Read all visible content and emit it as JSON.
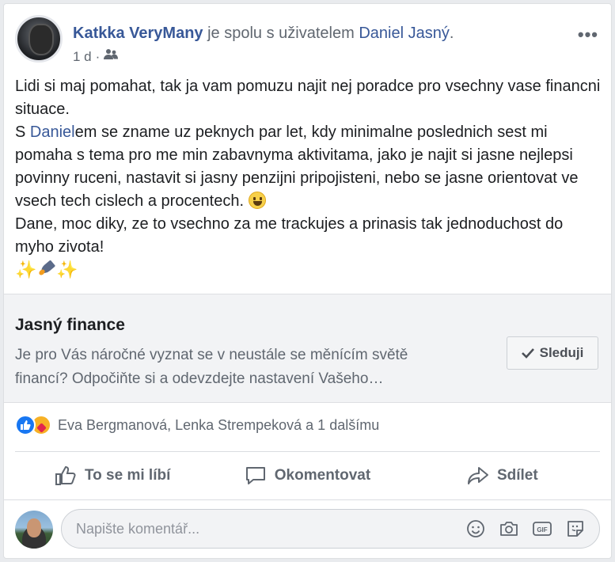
{
  "post": {
    "author": "Katkka VeryMany",
    "with_text": "je spolu s uživatelem",
    "tagged": "Daniel Jasný",
    "tagged_suffix": ".",
    "time": "1 d",
    "audience_icon": "friends-icon",
    "more_label": "•••",
    "text": {
      "line1": "Lidi si maj pomahat, tak ja vam pomuzu najit nej poradce pro vsechny vase financni situace.",
      "p2_pre": "S ",
      "p2_mention": "Daniel",
      "p2_post": "em se zname uz peknych par let, kdy minimalne poslednich sest mi pomaha s tema pro me min zabavnyma aktivitama, jako je najit si jasne nejlepsi povinny ruceni, nastavit si jasny penzijni pripojisteni, nebo se jasne orientovat ve vsech tech cislech a procentech. ",
      "p3": "Dane, moc diky, ze to vsechno za me trackujes a prinasis tak jednoduchost do myho zivota!",
      "sparkle": "✨"
    }
  },
  "page_card": {
    "name": "Jasný finance",
    "description": "Je pro Vás náročné vyznat se v neustále se měnícím světě financí? Odpočiňte si a odevzdejte nastavení Vašeho…",
    "follow_label": "Sleduji"
  },
  "reactions": {
    "names": "Eva Bergmanová, Lenka Strempeková a 1 dalšímu"
  },
  "actions": {
    "like": "To se mi líbí",
    "comment": "Okomentovat",
    "share": "Sdílet"
  },
  "comment": {
    "placeholder": "Napište komentář..."
  },
  "colors": {
    "link": "#385898",
    "like_blue": "#1877f2",
    "muted": "#606770"
  }
}
